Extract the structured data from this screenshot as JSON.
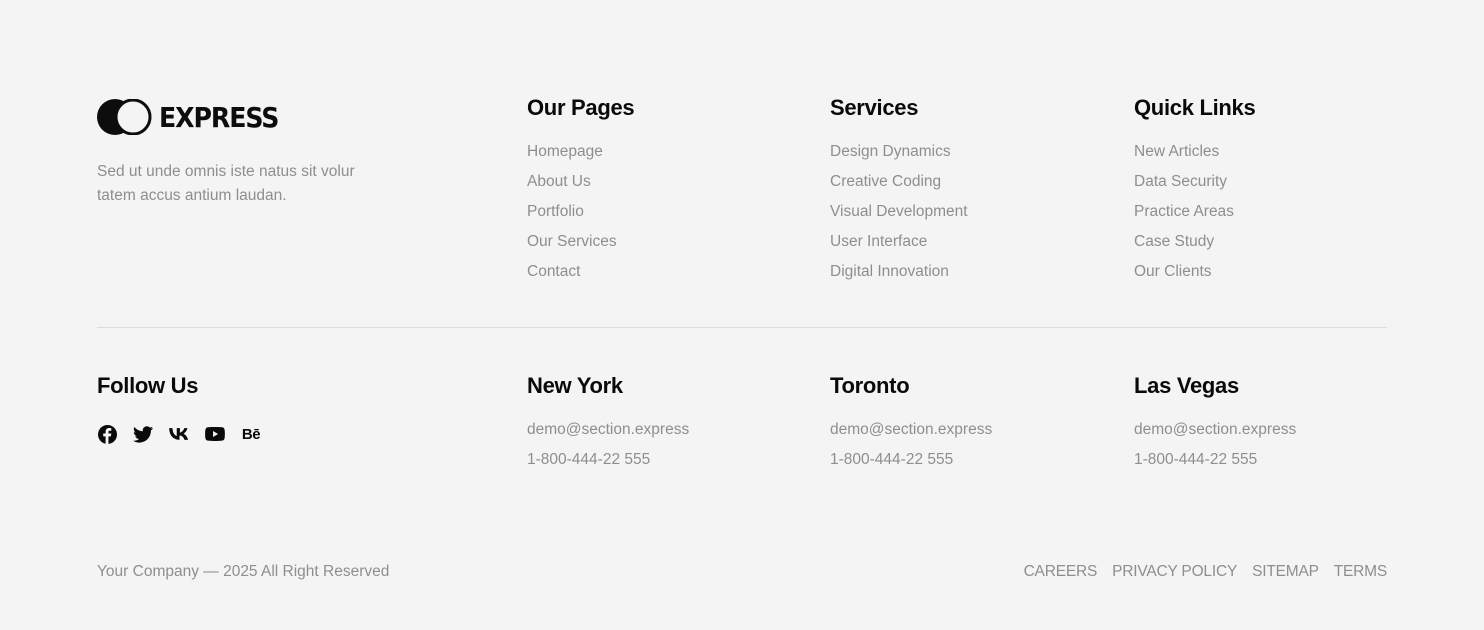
{
  "brand": {
    "name": "EXPRESS",
    "tagline": "Sed ut unde omnis iste natus sit volur tatem accus antium laudan."
  },
  "columns": [
    {
      "title": "Our Pages",
      "items": [
        "Homepage",
        "About Us",
        "Portfolio",
        "Our Services",
        "Contact"
      ]
    },
    {
      "title": "Services",
      "items": [
        "Design Dynamics",
        "Creative Coding",
        "Visual Development",
        "User Interface",
        "Digital Innovation"
      ]
    },
    {
      "title": "Quick Links",
      "items": [
        "New Articles",
        "Data Security",
        "Practice Areas",
        "Case Study",
        "Our Clients"
      ]
    }
  ],
  "follow": {
    "title": "Follow Us",
    "icons": [
      "facebook-icon",
      "twitter-icon",
      "vk-icon",
      "youtube-icon",
      "behance-icon"
    ],
    "behance_text": "Bē"
  },
  "offices": [
    {
      "city": "New York",
      "email": "demo@section.express",
      "phone": "1-800-444-22 555"
    },
    {
      "city": "Toronto",
      "email": "demo@section.express",
      "phone": "1-800-444-22 555"
    },
    {
      "city": "Las Vegas",
      "email": "demo@section.express",
      "phone": "1-800-444-22 555"
    }
  ],
  "bottom": {
    "copyright": "Your Company — 2025 All Right Reserved",
    "links": [
      "CAREERS",
      "PRIVACY POLICY",
      "SITEMAP",
      "TERMS"
    ]
  },
  "colors": {
    "background": "#f4f4f4",
    "heading": "#0a0a0a",
    "muted": "#8e8e8e",
    "divider": "#dcdcdc"
  }
}
